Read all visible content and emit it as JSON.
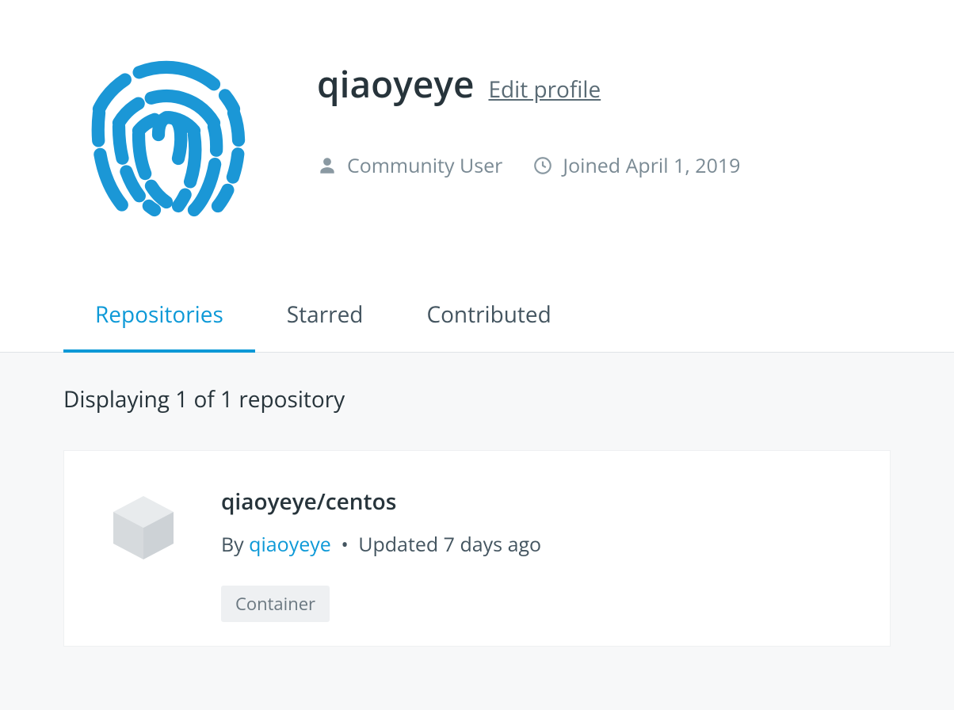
{
  "profile": {
    "username": "qiaoyeye",
    "edit_label": "Edit profile",
    "role": "Community User",
    "joined": "Joined April 1, 2019"
  },
  "tabs": [
    {
      "label": "Repositories",
      "active": true
    },
    {
      "label": "Starred",
      "active": false
    },
    {
      "label": "Contributed",
      "active": false
    }
  ],
  "list": {
    "count_text": "Displaying 1 of 1 repository"
  },
  "repos": [
    {
      "name": "qiaoyeye/centos",
      "by_prefix": "By ",
      "owner": "qiaoyeye",
      "updated": "Updated 7 days ago",
      "tag": "Container"
    }
  ],
  "colors": {
    "accent": "#0d99d7",
    "text": "#27343b",
    "muted": "#7a8a94"
  }
}
